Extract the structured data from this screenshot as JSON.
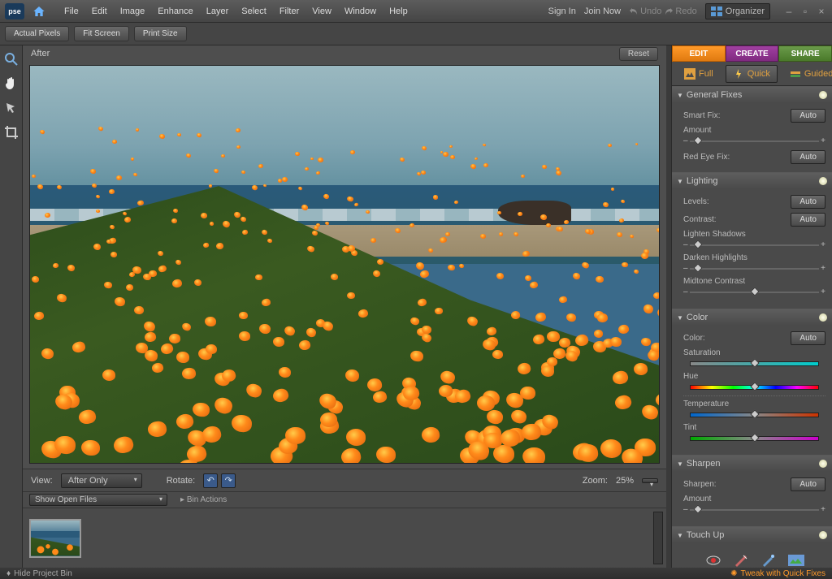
{
  "app": {
    "logo": "pse"
  },
  "menubar": [
    "File",
    "Edit",
    "Image",
    "Enhance",
    "Layer",
    "Select",
    "Filter",
    "View",
    "Window",
    "Help"
  ],
  "topright": {
    "signin": "Sign In",
    "joinnow": "Join Now",
    "undo": "Undo",
    "redo": "Redo",
    "organizer": "Organizer"
  },
  "secondbar": {
    "actual_pixels": "Actual Pixels",
    "fit_screen": "Fit Screen",
    "print_size": "Print Size"
  },
  "canvas": {
    "header": "After",
    "reset": "Reset"
  },
  "viewbar": {
    "view_label": "View:",
    "view_value": "After Only",
    "rotate_label": "Rotate:",
    "zoom_label": "Zoom:",
    "zoom_value": "25%"
  },
  "binbar": {
    "show_open": "Show Open Files",
    "bin_actions": "Bin Actions"
  },
  "footer": {
    "hide_bin": "Hide Project Bin",
    "tweak": "Tweak with Quick Fixes"
  },
  "modetabs": {
    "edit": "EDIT",
    "create": "CREATE",
    "share": "SHARE"
  },
  "submode": {
    "full": "Full",
    "quick": "Quick",
    "guided": "Guided"
  },
  "panels": {
    "general": {
      "title": "General Fixes",
      "smartfix": "Smart Fix:",
      "amount": "Amount",
      "redeye": "Red Eye Fix:",
      "auto": "Auto"
    },
    "lighting": {
      "title": "Lighting",
      "levels": "Levels:",
      "contrast": "Contrast:",
      "lighten": "Lighten Shadows",
      "darken": "Darken Highlights",
      "midtone": "Midtone Contrast",
      "auto": "Auto"
    },
    "color": {
      "title": "Color",
      "color": "Color:",
      "saturation": "Saturation",
      "hue": "Hue",
      "temperature": "Temperature",
      "tint": "Tint",
      "auto": "Auto"
    },
    "sharpen": {
      "title": "Sharpen",
      "sharpen": "Sharpen:",
      "amount": "Amount",
      "auto": "Auto"
    },
    "touchup": {
      "title": "Touch Up"
    }
  }
}
